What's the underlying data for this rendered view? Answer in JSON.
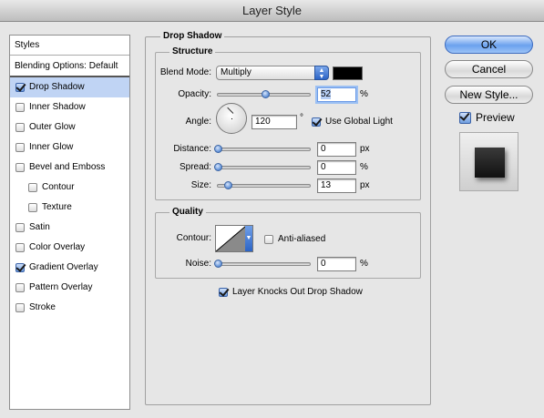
{
  "window": {
    "title": "Layer Style"
  },
  "styles_list": {
    "header": "Styles",
    "blending": "Blending Options: Default",
    "items": [
      {
        "label": "Drop Shadow",
        "checked": true,
        "selected": true,
        "sub": false
      },
      {
        "label": "Inner Shadow",
        "checked": false,
        "selected": false,
        "sub": false
      },
      {
        "label": "Outer Glow",
        "checked": false,
        "selected": false,
        "sub": false
      },
      {
        "label": "Inner Glow",
        "checked": false,
        "selected": false,
        "sub": false
      },
      {
        "label": "Bevel and Emboss",
        "checked": false,
        "selected": false,
        "sub": false
      },
      {
        "label": "Contour",
        "checked": false,
        "selected": false,
        "sub": true
      },
      {
        "label": "Texture",
        "checked": false,
        "selected": false,
        "sub": true
      },
      {
        "label": "Satin",
        "checked": false,
        "selected": false,
        "sub": false
      },
      {
        "label": "Color Overlay",
        "checked": false,
        "selected": false,
        "sub": false
      },
      {
        "label": "Gradient Overlay",
        "checked": true,
        "selected": false,
        "sub": false
      },
      {
        "label": "Pattern Overlay",
        "checked": false,
        "selected": false,
        "sub": false
      },
      {
        "label": "Stroke",
        "checked": false,
        "selected": false,
        "sub": false
      }
    ]
  },
  "drop_shadow": {
    "title": "Drop Shadow",
    "structure": {
      "title": "Structure",
      "blend_mode_label": "Blend Mode:",
      "blend_mode_value": "Multiply",
      "shadow_color": "#000000",
      "opacity_label": "Opacity:",
      "opacity_value": "52",
      "opacity_unit": "%",
      "opacity_level": 0.52,
      "angle_label": "Angle:",
      "angle_value": "120",
      "angle_unit": "°",
      "global_light_label": "Use Global Light",
      "global_light_checked": true,
      "distance_label": "Distance:",
      "distance_value": "0",
      "distance_unit": "px",
      "spread_label": "Spread:",
      "spread_value": "0",
      "spread_unit": "%",
      "size_label": "Size:",
      "size_value": "13",
      "size_unit": "px"
    },
    "quality": {
      "title": "Quality",
      "contour_label": "Contour:",
      "anti_aliased_label": "Anti-aliased",
      "anti_aliased_checked": false,
      "noise_label": "Noise:",
      "noise_value": "0",
      "noise_unit": "%"
    },
    "knockout_label": "Layer Knocks Out Drop Shadow",
    "knockout_checked": true
  },
  "buttons": {
    "ok": "OK",
    "cancel": "Cancel",
    "new_style": "New Style...",
    "preview_label": "Preview",
    "preview_checked": true
  }
}
